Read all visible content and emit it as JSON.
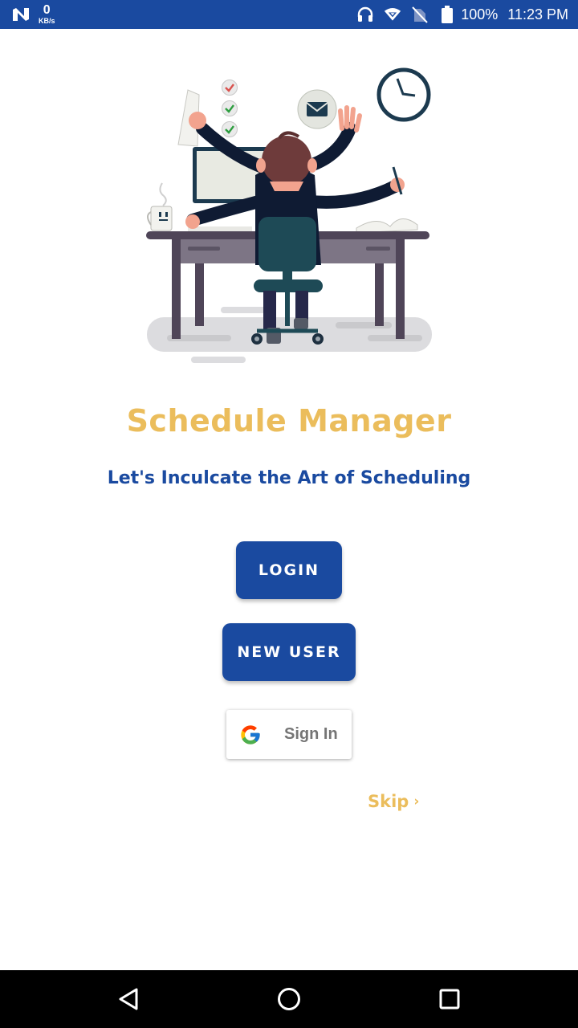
{
  "status_bar": {
    "net_speed_value": "0",
    "net_speed_unit": "KB/s",
    "battery_percent": "100%",
    "time": "11:23 PM",
    "icons": [
      "n-logo-icon",
      "headphones-icon",
      "wifi-icon",
      "no-sim-icon",
      "battery-icon"
    ]
  },
  "hero": {
    "illustration": "person-multitasking-at-desk-illustration"
  },
  "title": "Schedule Manager",
  "tagline": "Let's Inculcate the Art of Scheduling",
  "buttons": {
    "login": "LOGIN",
    "new_user": "NEW USER"
  },
  "google": {
    "label": "Sign In",
    "icon": "google-g-icon"
  },
  "skip": {
    "label": "Skip",
    "chevron": "›"
  },
  "nav_bar": {
    "icons": [
      "back-icon",
      "home-icon",
      "recents-icon"
    ]
  },
  "colors": {
    "status_bar": "#1a4aa0",
    "primary": "#1a4aa0",
    "accent_gold": "#ebbd5c",
    "nav_bar": "#000000"
  }
}
